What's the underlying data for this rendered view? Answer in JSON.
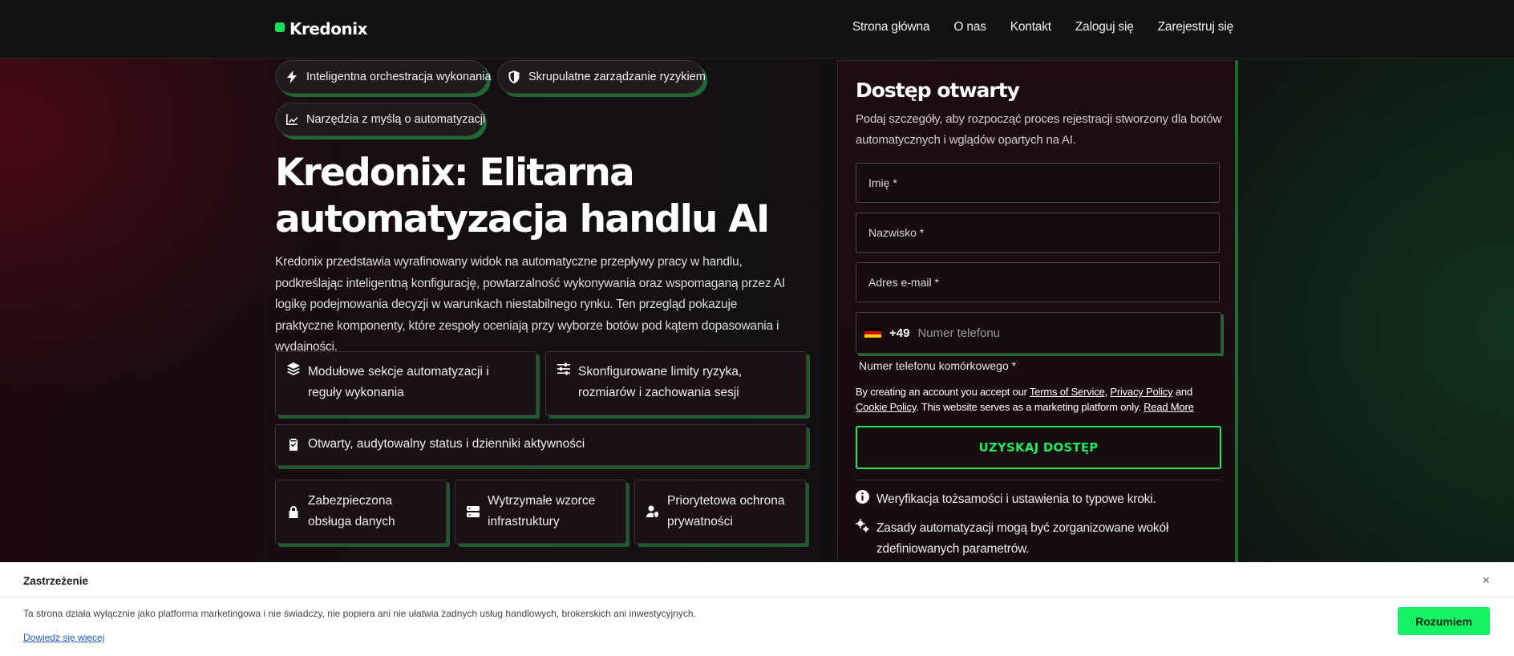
{
  "header": {
    "brand": "Kredonix",
    "nav": [
      "Strona główna",
      "O nas",
      "Kontakt",
      "Zaloguj się",
      "Zarejestruj się"
    ]
  },
  "pills": [
    {
      "label": "Inteligentna orchestracja wykonania",
      "icon": "bolt-icon"
    },
    {
      "label": "Skrupulatne zarządzanie ryzykiem",
      "icon": "shield-icon"
    },
    {
      "label": "Narzędzia z myślą o automatyzacji",
      "icon": "chart-line-icon"
    }
  ],
  "hero": {
    "title": "Kredonix: Elitarna automatyzacja handlu AI",
    "description": "Kredonix przedstawia wyrafinowany widok na automatyczne przepływy pracy w handlu, podkreślając inteligentną konfigurację, powtarzalność wykonywania oraz wspomaganą przez AI logikę podejmowania decyzji w warunkach niestabilnego rynku. Ten przegląd pokazuje praktyczne komponenty, które zespoły oceniają przy wyborze botów pod kątem dopasowania i wydajności."
  },
  "features": [
    {
      "label": "Modułowe sekcje automatyzacji i reguły wykonania",
      "icon": "layers-icon"
    },
    {
      "label": "Skonfigurowane limity ryzyka, rozmiarów i zachowania sesji",
      "icon": "sliders-icon"
    },
    {
      "label": "Otwarty, audytowalny status i dzienniki aktywności",
      "icon": "clipboard-check-icon"
    },
    {
      "label": "Zabezpieczona obsługa danych",
      "icon": "lock-icon"
    },
    {
      "label": "Wytrzymałe wzorce infrastruktury",
      "icon": "server-icon"
    },
    {
      "label": "Priorytetowa ochrona prywatności",
      "icon": "user-shield-icon"
    }
  ],
  "form": {
    "title": "Dostęp otwarty",
    "subtitle": "Podaj szczegóły, aby rozpocząć proces rejestracji stworzony dla botów automatycznych i wglądów opartych na AI.",
    "first_name": "Imię *",
    "last_name": "Nazwisko *",
    "email": "Adres e-mail *",
    "phone_code": "+49",
    "phone_placeholder": "Numer telefonu",
    "phone_label": "Numer telefonu komórkowego *",
    "terms_pre": "By creating an account you accept our ",
    "terms_tos": "Terms of Service",
    "terms_comma": ", ",
    "terms_privacy": "Privacy Policy",
    "terms_and": " and ",
    "terms_cookie": "Cookie Policy",
    "terms_post": ". This website serves as a marketing platform only. ",
    "terms_readmore": "Read More",
    "submit": "UZYSKAJ DOSTĘP",
    "info": [
      {
        "label": "Weryfikacja tożsamości i ustawienia to typowe kroki.",
        "icon": "info-icon"
      },
      {
        "label": "Zasady automatyzacji mogą być zorganizowane wokół zdefiniowanych parametrów.",
        "icon": "gears-icon"
      }
    ]
  },
  "cookie": {
    "title": "Zastrzeżenie",
    "text": "Ta strona działa wyłącznie jako platforma marketingowa i nie świadczy, nie popiera ani nie ułatwia żadnych usług handlowych, brokerskich ani inwestycyjnych.",
    "link": "Dowiedz się więcej",
    "button": "Rozumiem",
    "close": "×"
  },
  "colors": {
    "accent": "#1ee85c",
    "card_shadow": "#1f6a33",
    "cookie_button": "#16f064"
  }
}
